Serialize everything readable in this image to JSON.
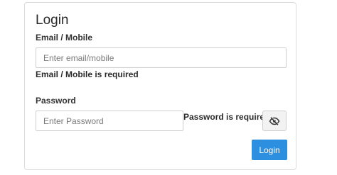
{
  "form": {
    "title": "Login",
    "email": {
      "label": "Email / Mobile",
      "placeholder": "Enter email/mobile",
      "value": "",
      "error": "Email / Mobile is required"
    },
    "password": {
      "label": "Password",
      "placeholder": "Enter Password",
      "value": "",
      "error": "Password is required",
      "toggle_icon": "eye-slash-icon"
    },
    "submit_label": "Login"
  },
  "colors": {
    "primary": "#2c8fe0",
    "border": "#cfcfcf",
    "card_border": "#dcdcdc",
    "toggle_bg": "#f2f2f2"
  }
}
